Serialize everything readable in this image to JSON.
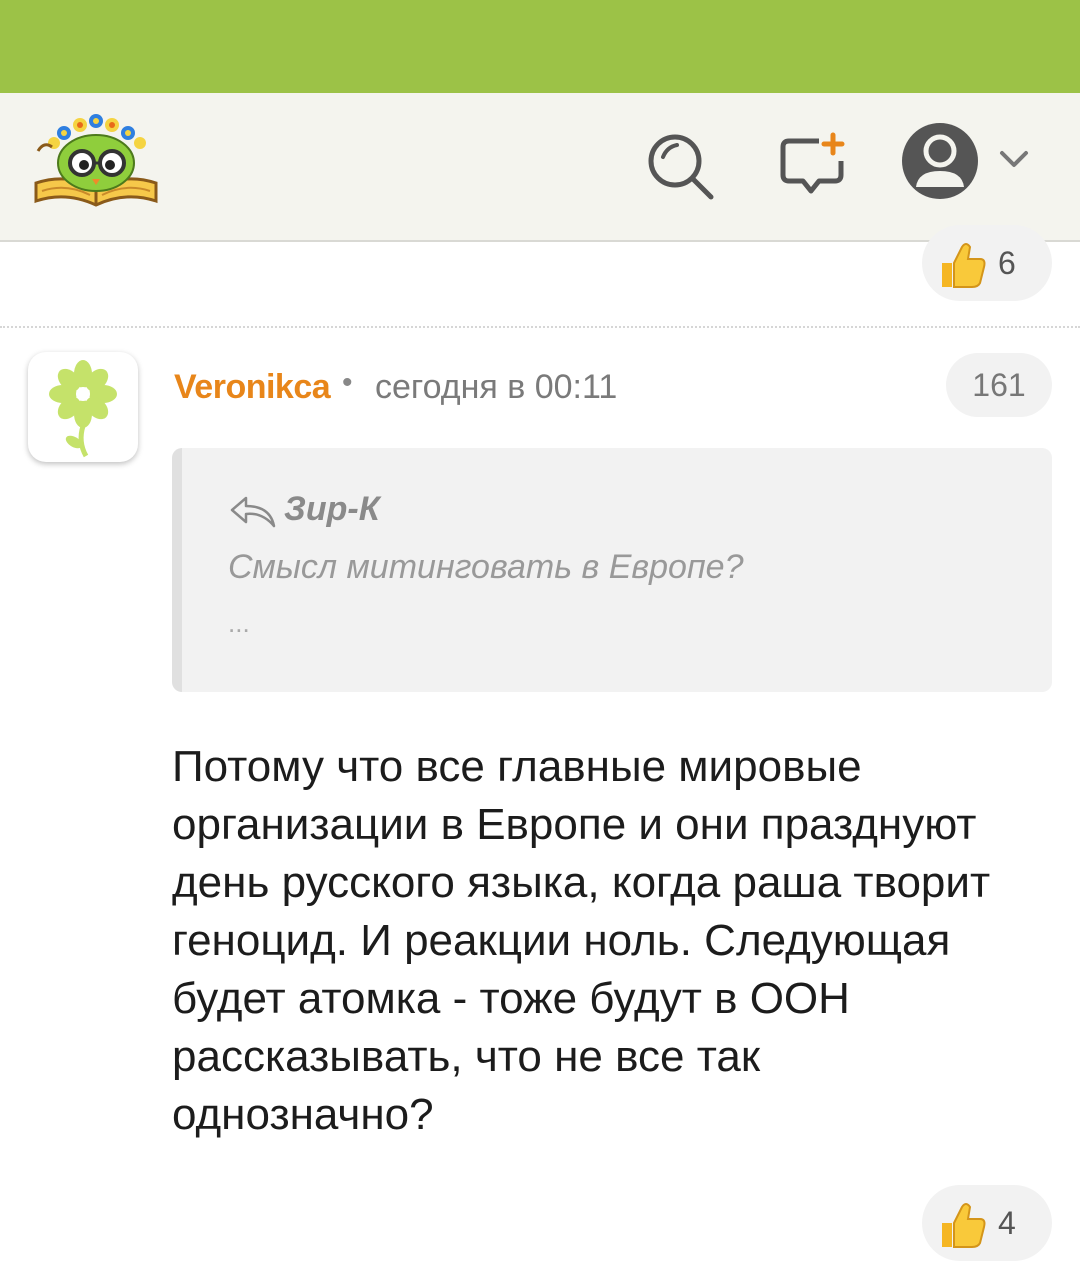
{
  "header": {
    "logo_icon": "owl-with-flower-wreath-on-book-logo",
    "search_icon": "search-icon",
    "compose_icon": "new-message-icon",
    "profile_icon": "user-avatar-icon",
    "dropdown_icon": "chevron-down-icon"
  },
  "previous_comment": {
    "like_count": "6"
  },
  "comment": {
    "author": "Veronikca",
    "separator": "•",
    "timestamp": "сегодня в 00:11",
    "counter": "161",
    "quote": {
      "author": "Зир-К",
      "text": "Смысл митинговать в Европе?",
      "ellipsis": "..."
    },
    "body_lines": [
      "Потому что все главные мировые",
      "организации в Европе и они празднуют",
      "день русского языка, когда раша творит",
      "геноцид. И реакции ноль. Следующая",
      "будет атомка - тоже будут в ООН",
      "рассказывать, что не все так",
      "однозначно?"
    ],
    "like_count": "4"
  },
  "colors": {
    "statusbar": "#9cc247",
    "header_bg": "#f4f4ee",
    "author": "#e8861a",
    "avatar_flower": "#c5e26a"
  }
}
